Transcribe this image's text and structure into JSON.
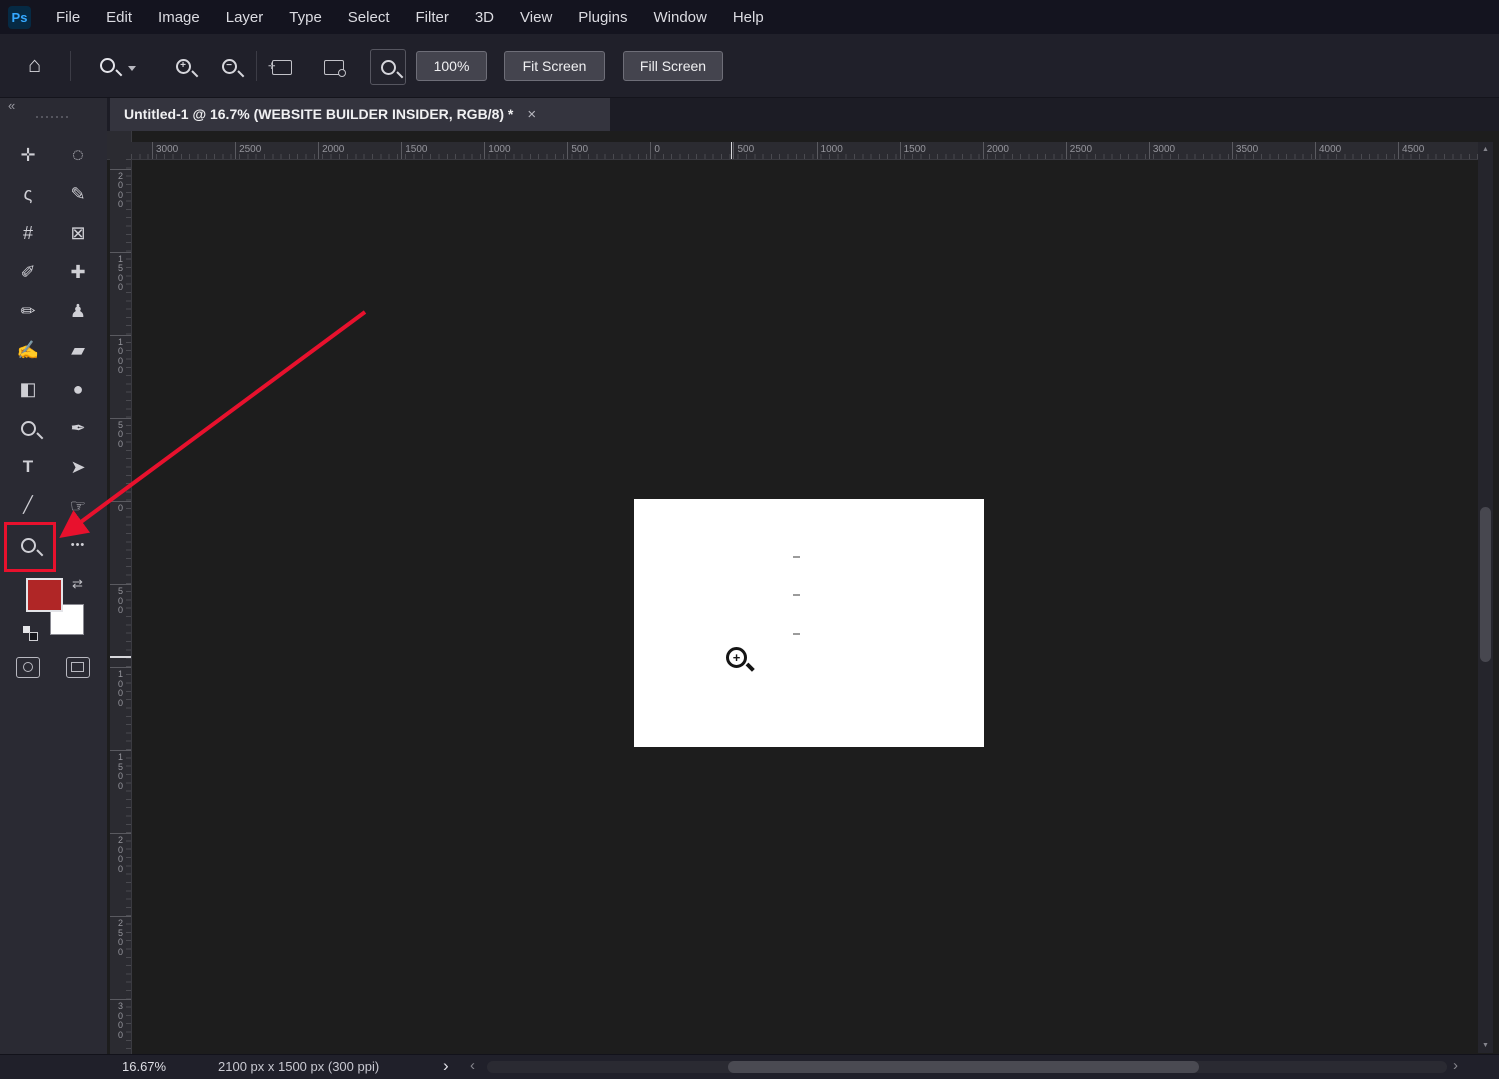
{
  "menubar": {
    "logo": "Ps",
    "items": [
      {
        "label": "File"
      },
      {
        "label": "Edit"
      },
      {
        "label": "Image"
      },
      {
        "label": "Layer"
      },
      {
        "label": "Type"
      },
      {
        "label": "Select"
      },
      {
        "label": "Filter"
      },
      {
        "label": "3D"
      },
      {
        "label": "View"
      },
      {
        "label": "Plugins"
      },
      {
        "label": "Window"
      },
      {
        "label": "Help"
      }
    ]
  },
  "options": {
    "zoom_percent": "100%",
    "fit_screen": "Fit Screen",
    "fill_screen": "Fill Screen"
  },
  "tab": {
    "title": "Untitled-1 @ 16.7% (WEBSITE BUILDER INSIDER, RGB/8) *",
    "close_icon": "×"
  },
  "panel": {
    "collapse_label": "«"
  },
  "toolbar": {
    "tools": [
      {
        "name": "move-tool",
        "icon": "✛"
      },
      {
        "name": "elliptical-marquee-tool",
        "icon": "◌"
      },
      {
        "name": "lasso-tool",
        "icon": "ς"
      },
      {
        "name": "quick-selection-tool",
        "icon": "✎"
      },
      {
        "name": "crop-tool",
        "icon": "#"
      },
      {
        "name": "frame-tool",
        "icon": "⊠"
      },
      {
        "name": "eyedropper-tool",
        "icon": "✐"
      },
      {
        "name": "spot-healing-brush-tool",
        "icon": "✚"
      },
      {
        "name": "brush-tool",
        "icon": "✏"
      },
      {
        "name": "clone-stamp-tool",
        "icon": "♟"
      },
      {
        "name": "history-brush-tool",
        "icon": "✍"
      },
      {
        "name": "eraser-tool",
        "icon": "▰"
      },
      {
        "name": "gradient-tool",
        "icon": "◧"
      },
      {
        "name": "blur-tool",
        "icon": "●"
      },
      {
        "name": "dodge-tool",
        "icon": "magnifier"
      },
      {
        "name": "pen-tool",
        "icon": "✒"
      },
      {
        "name": "type-tool",
        "icon": "T"
      },
      {
        "name": "path-selection-tool",
        "icon": "➤"
      },
      {
        "name": "line-tool",
        "icon": "╱"
      },
      {
        "name": "hand-tool",
        "icon": "☞"
      },
      {
        "name": "zoom-tool",
        "icon": "magnifier"
      },
      {
        "name": "more-tools",
        "icon": "•••"
      }
    ]
  },
  "rulers": {
    "horizontal": [
      "3000",
      "2500",
      "2000",
      "1500",
      "1000",
      "500",
      "0",
      "500",
      "1000",
      "1500",
      "2000",
      "2500",
      "3000",
      "3500",
      "4000",
      "4500"
    ],
    "vertical": [
      "2000",
      "1500",
      "1000",
      "500",
      "0",
      "500",
      "1000",
      "1500",
      "2000",
      "2500",
      "3000"
    ]
  },
  "statusbar": {
    "zoom_level": "16.67%",
    "document_info": "2100 px x 1500 px (300 ppi)"
  },
  "icons": {
    "home": "⌂",
    "chevron_right": "›",
    "chevron_left": "‹",
    "scroll_up": "▲",
    "scroll_down": "▼",
    "swap": "⇄"
  },
  "colors": {
    "accent_red": "#e8112d",
    "foreground_color": "#b02626",
    "background_color": "#ffffff"
  }
}
